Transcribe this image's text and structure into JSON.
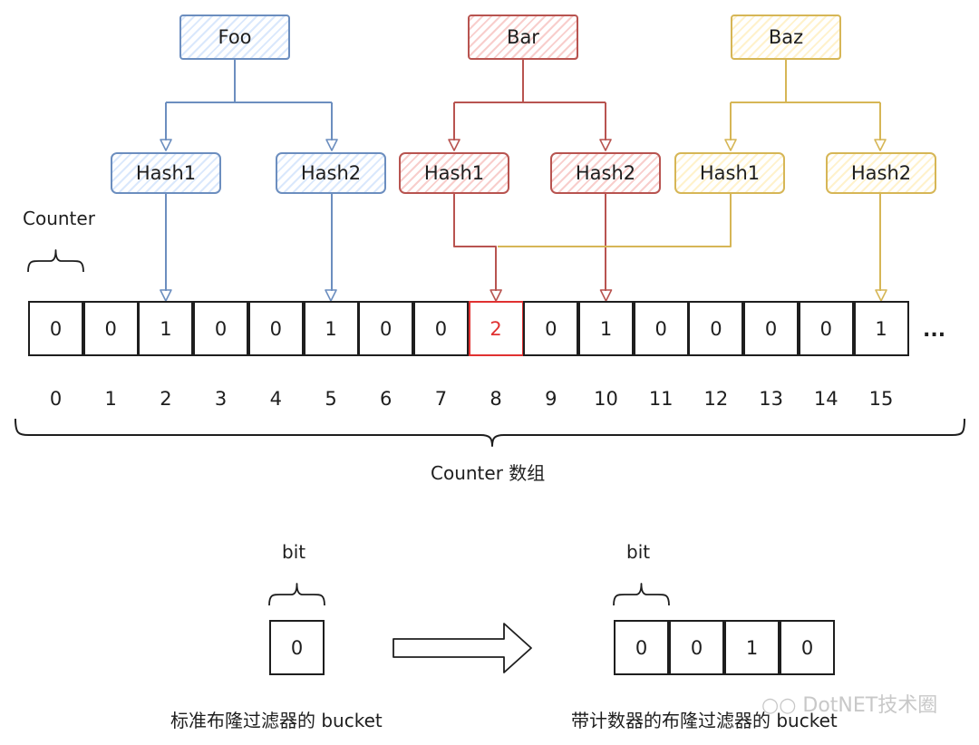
{
  "colors": {
    "foo": "#6c8ebf",
    "bar": "#b85450",
    "baz": "#d6b656",
    "highlight": "#e03131",
    "ink": "#1e1e1e"
  },
  "elements": [
    {
      "name": "Foo",
      "color_key": "foo",
      "hashes": [
        {
          "label": "Hash1",
          "target": 2
        },
        {
          "label": "Hash2",
          "target": 5
        }
      ]
    },
    {
      "name": "Bar",
      "color_key": "bar",
      "hashes": [
        {
          "label": "Hash1",
          "target": 8
        },
        {
          "label": "Hash2",
          "target": 10
        }
      ]
    },
    {
      "name": "Baz",
      "color_key": "baz",
      "hashes": [
        {
          "label": "Hash1",
          "target": 8
        },
        {
          "label": "Hash2",
          "target": 15
        }
      ]
    }
  ],
  "counter_array": {
    "cell_label": "Counter",
    "values": [
      0,
      0,
      1,
      0,
      0,
      1,
      0,
      0,
      2,
      0,
      1,
      0,
      0,
      0,
      0,
      1
    ],
    "indices": [
      "0",
      "1",
      "2",
      "3",
      "4",
      "5",
      "6",
      "7",
      "8",
      "9",
      "10",
      "11",
      "12",
      "13",
      "14",
      "15"
    ],
    "highlighted_index": 8,
    "ellipsis": "...",
    "caption": "Counter 数组"
  },
  "comparison": {
    "standard": {
      "brace_label": "bit",
      "bits": [
        "0"
      ],
      "caption": "标准布隆过滤器的 bucket"
    },
    "counting": {
      "brace_label": "bit",
      "bits": [
        "0",
        "0",
        "1",
        "0"
      ],
      "caption": "带计数器的布隆过滤器的 bucket"
    }
  },
  "watermark": "DotNET技术圈"
}
